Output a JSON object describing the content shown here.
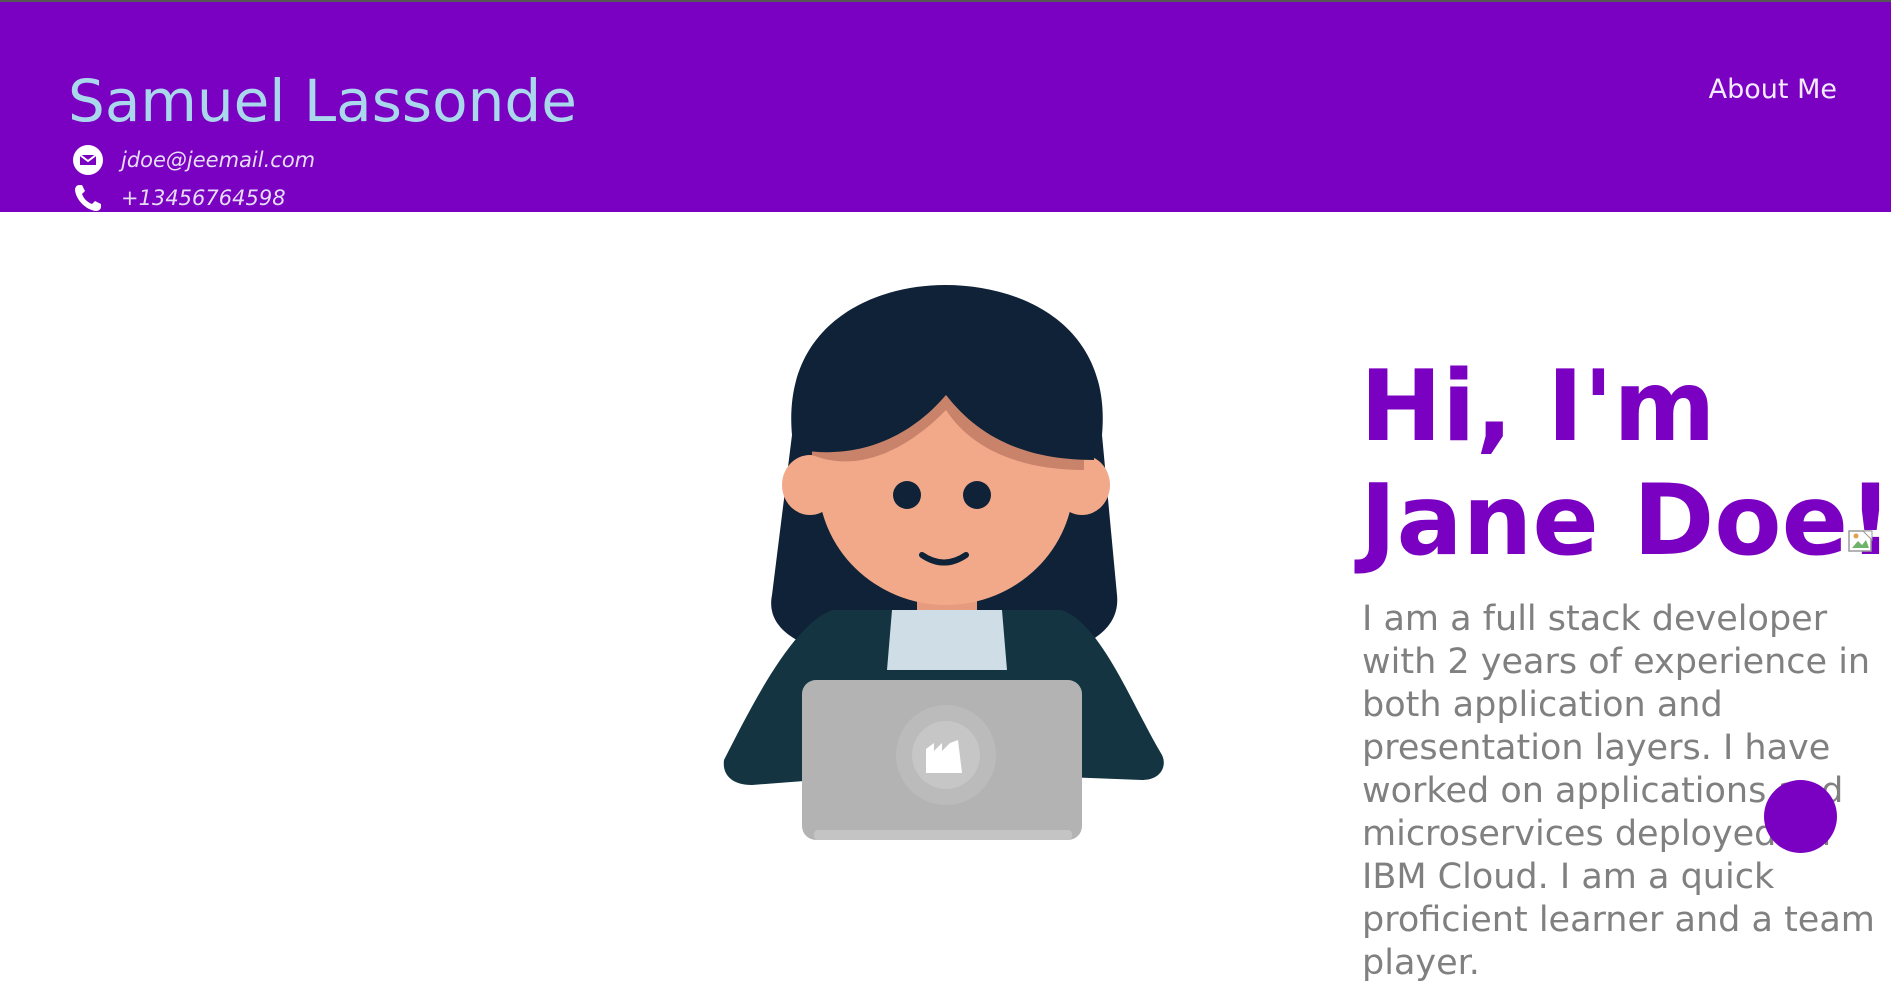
{
  "header": {
    "name": "Samuel Lassonde",
    "email": "jdoe@jeemail.com",
    "phone": "+13456764598",
    "email_icon": "envelope-icon",
    "phone_icon": "phone-icon",
    "background_color": "#7a00c2",
    "name_color": "#a9d8ec"
  },
  "nav": {
    "about_label": "About Me"
  },
  "hero": {
    "title_line1": "Hi, I'm",
    "title_line2": "Jane Doe!",
    "bio": "I am a full stack developer with 2 years of experience in both application and presentation layers. I have worked on applications and microservices deployed on IBM Cloud. I am a quick proficient learner and a team player.",
    "title_color": "#7a00c2",
    "avatar": "developer-avatar-illustration",
    "image_icon": "broken-image-icon"
  },
  "fab": {
    "color": "#7a00c2"
  }
}
